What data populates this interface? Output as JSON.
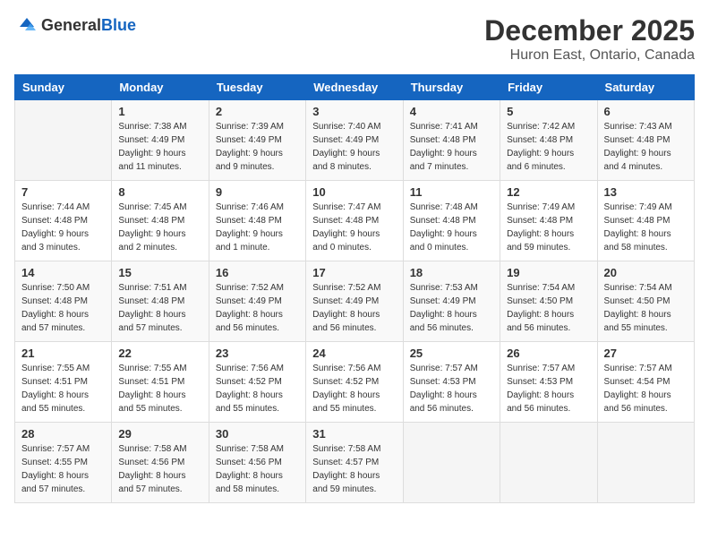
{
  "logo": {
    "text_general": "General",
    "text_blue": "Blue"
  },
  "header": {
    "month": "December 2025",
    "location": "Huron East, Ontario, Canada"
  },
  "weekdays": [
    "Sunday",
    "Monday",
    "Tuesday",
    "Wednesday",
    "Thursday",
    "Friday",
    "Saturday"
  ],
  "weeks": [
    [
      {
        "day": "",
        "info": ""
      },
      {
        "day": "1",
        "info": "Sunrise: 7:38 AM\nSunset: 4:49 PM\nDaylight: 9 hours\nand 11 minutes."
      },
      {
        "day": "2",
        "info": "Sunrise: 7:39 AM\nSunset: 4:49 PM\nDaylight: 9 hours\nand 9 minutes."
      },
      {
        "day": "3",
        "info": "Sunrise: 7:40 AM\nSunset: 4:49 PM\nDaylight: 9 hours\nand 8 minutes."
      },
      {
        "day": "4",
        "info": "Sunrise: 7:41 AM\nSunset: 4:48 PM\nDaylight: 9 hours\nand 7 minutes."
      },
      {
        "day": "5",
        "info": "Sunrise: 7:42 AM\nSunset: 4:48 PM\nDaylight: 9 hours\nand 6 minutes."
      },
      {
        "day": "6",
        "info": "Sunrise: 7:43 AM\nSunset: 4:48 PM\nDaylight: 9 hours\nand 4 minutes."
      }
    ],
    [
      {
        "day": "7",
        "info": "Sunrise: 7:44 AM\nSunset: 4:48 PM\nDaylight: 9 hours\nand 3 minutes."
      },
      {
        "day": "8",
        "info": "Sunrise: 7:45 AM\nSunset: 4:48 PM\nDaylight: 9 hours\nand 2 minutes."
      },
      {
        "day": "9",
        "info": "Sunrise: 7:46 AM\nSunset: 4:48 PM\nDaylight: 9 hours\nand 1 minute."
      },
      {
        "day": "10",
        "info": "Sunrise: 7:47 AM\nSunset: 4:48 PM\nDaylight: 9 hours\nand 0 minutes."
      },
      {
        "day": "11",
        "info": "Sunrise: 7:48 AM\nSunset: 4:48 PM\nDaylight: 9 hours\nand 0 minutes."
      },
      {
        "day": "12",
        "info": "Sunrise: 7:49 AM\nSunset: 4:48 PM\nDaylight: 8 hours\nand 59 minutes."
      },
      {
        "day": "13",
        "info": "Sunrise: 7:49 AM\nSunset: 4:48 PM\nDaylight: 8 hours\nand 58 minutes."
      }
    ],
    [
      {
        "day": "14",
        "info": "Sunrise: 7:50 AM\nSunset: 4:48 PM\nDaylight: 8 hours\nand 57 minutes."
      },
      {
        "day": "15",
        "info": "Sunrise: 7:51 AM\nSunset: 4:48 PM\nDaylight: 8 hours\nand 57 minutes."
      },
      {
        "day": "16",
        "info": "Sunrise: 7:52 AM\nSunset: 4:49 PM\nDaylight: 8 hours\nand 56 minutes."
      },
      {
        "day": "17",
        "info": "Sunrise: 7:52 AM\nSunset: 4:49 PM\nDaylight: 8 hours\nand 56 minutes."
      },
      {
        "day": "18",
        "info": "Sunrise: 7:53 AM\nSunset: 4:49 PM\nDaylight: 8 hours\nand 56 minutes."
      },
      {
        "day": "19",
        "info": "Sunrise: 7:54 AM\nSunset: 4:50 PM\nDaylight: 8 hours\nand 56 minutes."
      },
      {
        "day": "20",
        "info": "Sunrise: 7:54 AM\nSunset: 4:50 PM\nDaylight: 8 hours\nand 55 minutes."
      }
    ],
    [
      {
        "day": "21",
        "info": "Sunrise: 7:55 AM\nSunset: 4:51 PM\nDaylight: 8 hours\nand 55 minutes."
      },
      {
        "day": "22",
        "info": "Sunrise: 7:55 AM\nSunset: 4:51 PM\nDaylight: 8 hours\nand 55 minutes."
      },
      {
        "day": "23",
        "info": "Sunrise: 7:56 AM\nSunset: 4:52 PM\nDaylight: 8 hours\nand 55 minutes."
      },
      {
        "day": "24",
        "info": "Sunrise: 7:56 AM\nSunset: 4:52 PM\nDaylight: 8 hours\nand 55 minutes."
      },
      {
        "day": "25",
        "info": "Sunrise: 7:57 AM\nSunset: 4:53 PM\nDaylight: 8 hours\nand 56 minutes."
      },
      {
        "day": "26",
        "info": "Sunrise: 7:57 AM\nSunset: 4:53 PM\nDaylight: 8 hours\nand 56 minutes."
      },
      {
        "day": "27",
        "info": "Sunrise: 7:57 AM\nSunset: 4:54 PM\nDaylight: 8 hours\nand 56 minutes."
      }
    ],
    [
      {
        "day": "28",
        "info": "Sunrise: 7:57 AM\nSunset: 4:55 PM\nDaylight: 8 hours\nand 57 minutes."
      },
      {
        "day": "29",
        "info": "Sunrise: 7:58 AM\nSunset: 4:56 PM\nDaylight: 8 hours\nand 57 minutes."
      },
      {
        "day": "30",
        "info": "Sunrise: 7:58 AM\nSunset: 4:56 PM\nDaylight: 8 hours\nand 58 minutes."
      },
      {
        "day": "31",
        "info": "Sunrise: 7:58 AM\nSunset: 4:57 PM\nDaylight: 8 hours\nand 59 minutes."
      },
      {
        "day": "",
        "info": ""
      },
      {
        "day": "",
        "info": ""
      },
      {
        "day": "",
        "info": ""
      }
    ]
  ]
}
